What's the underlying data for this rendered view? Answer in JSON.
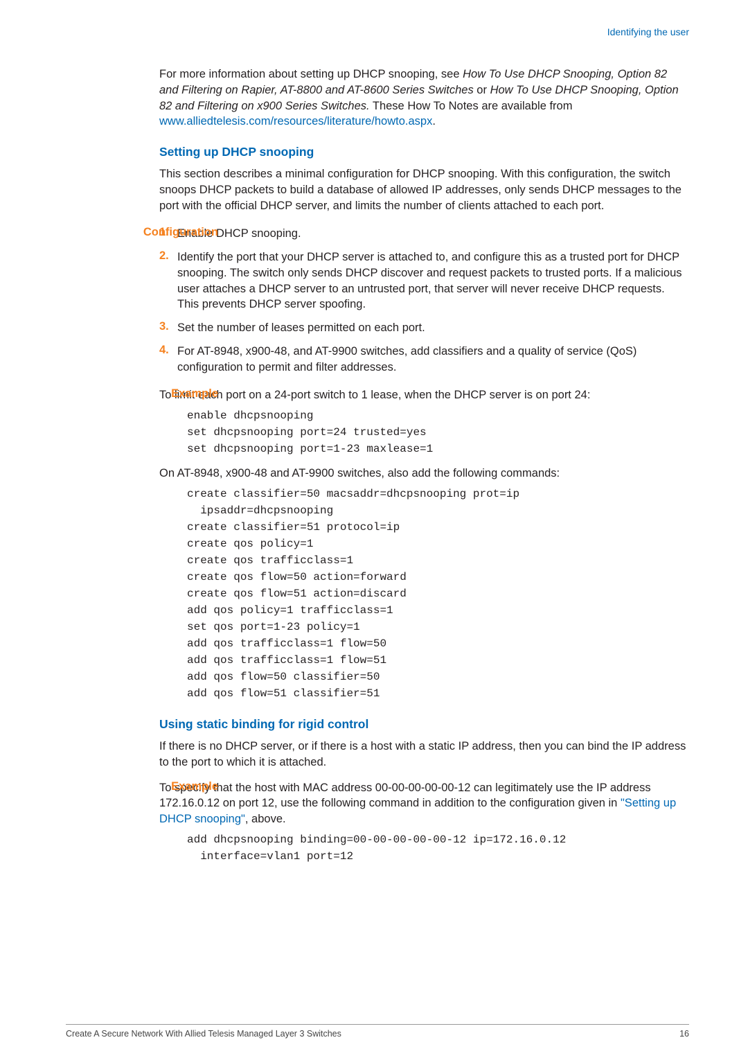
{
  "header": {
    "section_link": "Identifying the user"
  },
  "intro": {
    "para1_pre": "For more information about setting up DHCP snooping, see ",
    "para1_em1": "How To Use DHCP Snooping, Option 82 and Filtering on Rapier, AT-8800 and AT-8600 Series Switches",
    "para1_mid": " or ",
    "para1_em2": "How To Use DHCP Snooping, Option 82 and Filtering on x900 Series Switches.",
    "para1_post": " These How To Notes are available from ",
    "para1_link": "www.alliedtelesis.com/resources/literature/howto.aspx",
    "para1_end": "."
  },
  "sec1": {
    "heading": "Setting up DHCP snooping",
    "para": "This section describes a minimal configuration for DHCP snooping. With this configuration, the switch snoops DHCP packets to build a database of allowed IP addresses, only sends DHCP messages to the port with the official DHCP server, and limits the number of clients attached to each port."
  },
  "config": {
    "label": "Configuration",
    "n1": "1.",
    "t1": "Enable DHCP snooping.",
    "n2": "2.",
    "t2": "Identify the port that your DHCP server is attached to, and configure this as a trusted port for DHCP snooping. The switch only sends DHCP discover and request packets to trusted ports. If a malicious user attaches a DHCP server to an untrusted port, that server will never receive DHCP requests. This prevents DHCP server spoofing.",
    "n3": "3.",
    "t3": "Set the number of leases permitted on each port.",
    "n4": "4.",
    "t4": "For AT-8948, x900-48, and AT-9900 switches, add classifiers and a quality of service (QoS) configuration to permit and filter addresses."
  },
  "example1": {
    "label": "Example",
    "lead": "To limit each port on a 24-port switch to 1 lease, when the DHCP server is on port 24:",
    "code1": "enable dhcpsnooping\nset dhcpsnooping port=24 trusted=yes\nset dhcpsnooping port=1-23 maxlease=1",
    "para2": "On AT-8948, x900-48 and AT-9900 switches, also add the following commands:",
    "code2": "create classifier=50 macsaddr=dhcpsnooping prot=ip\n  ipsaddr=dhcpsnooping\ncreate classifier=51 protocol=ip\ncreate qos policy=1\ncreate qos trafficclass=1\ncreate qos flow=50 action=forward\ncreate qos flow=51 action=discard\nadd qos policy=1 trafficclass=1\nset qos port=1-23 policy=1\nadd qos trafficclass=1 flow=50\nadd qos trafficclass=1 flow=51\nadd qos flow=50 classifier=50\nadd qos flow=51 classifier=51"
  },
  "sec2": {
    "heading": "Using static binding for rigid control",
    "para": "If there is no DHCP server, or if there is a host with a static IP address, then you can bind the IP address to the port to which it is attached."
  },
  "example2": {
    "label": "Example",
    "lead_pre": "To specify that the host with MAC address 00-00-00-00-00-12 can legitimately use the IP address 172.16.0.12 on port 12, use the following command in addition to the configuration given in ",
    "lead_link": "\"Setting up DHCP snooping\"",
    "lead_post": ", above.",
    "code": "add dhcpsnooping binding=00-00-00-00-00-12 ip=172.16.0.12\n  interface=vlan1 port=12"
  },
  "footer": {
    "left": "Create A Secure Network With Allied Telesis Managed Layer 3 Switches",
    "right": "16"
  }
}
